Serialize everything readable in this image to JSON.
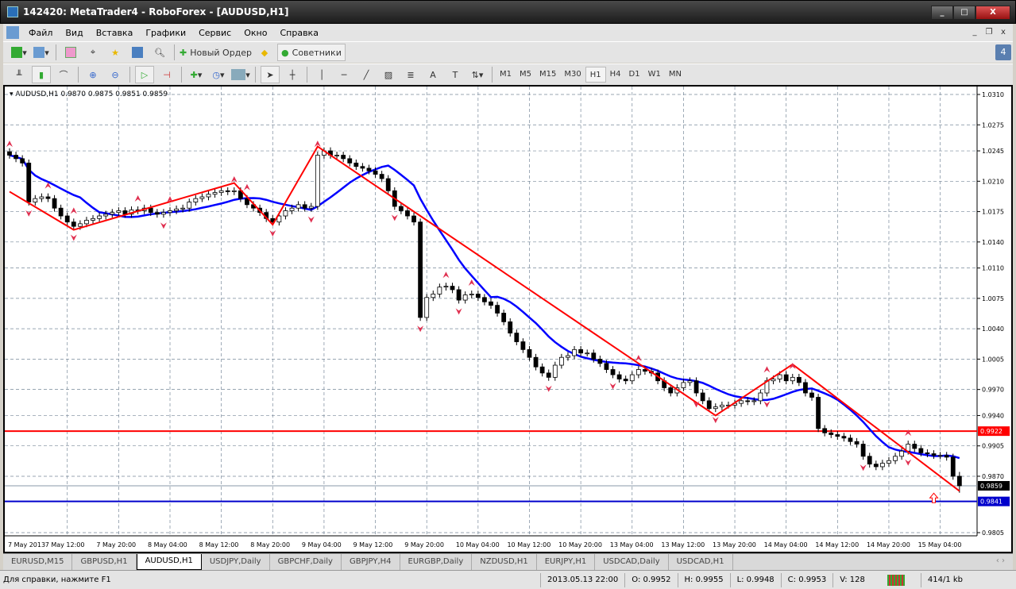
{
  "window": {
    "title": "142420: MetaTrader4 - RoboForex - [AUDUSD,H1]",
    "minimize": "_",
    "maximize": "□",
    "close": "X"
  },
  "menu": [
    "Файл",
    "Вид",
    "Вставка",
    "Графики",
    "Сервис",
    "Окно",
    "Справка"
  ],
  "mdi": {
    "minimize": "_",
    "restore": "❐",
    "close": "x"
  },
  "toolbar1": {
    "new_order": "Новый Ордер",
    "experts": "Советники",
    "notifications": "4"
  },
  "timeframes": [
    "M1",
    "M5",
    "M15",
    "M30",
    "H1",
    "H4",
    "D1",
    "W1",
    "MN"
  ],
  "active_timeframe": "H1",
  "chart_header": "AUDUSD,H1  0.9870 0.9875 0.9851 0.9859",
  "tabs": [
    "EURUSD,M15",
    "GBPUSD,H1",
    "AUDUSD,H1",
    "USDJPY,Daily",
    "GBPCHF,Daily",
    "GBPJPY,H4",
    "EURGBP,Daily",
    "NZDUSD,H1",
    "EURJPY,H1",
    "USDCAD,Daily",
    "USDCAD,H1"
  ],
  "active_tab": "AUDUSD,H1",
  "status": {
    "help": "Для справки, нажмите F1",
    "time": "2013.05.13 22:00",
    "open": "O: 0.9952",
    "high": "H: 0.9955",
    "low": "L: 0.9948",
    "close": "C: 0.9953",
    "volume": "V: 128",
    "traffic": "414/1 kb"
  },
  "colors": {
    "bull": "#ffffff",
    "bear": "#000000",
    "ma": "#0000ff",
    "zigzag": "#ff0000",
    "resistance": "#ff0000",
    "support": "#0000cc",
    "grid": "#778899"
  },
  "chart_data": {
    "type": "candlestick",
    "symbol": "AUDUSD",
    "timeframe": "H1",
    "closes": [
      1.024,
      1.0236,
      1.0231,
      1.0186,
      1.019,
      1.0192,
      1.019,
      1.0179,
      1.017,
      1.0163,
      1.0158,
      1.0161,
      1.0165,
      1.0167,
      1.017,
      1.0172,
      1.0174,
      1.0176,
      1.0172,
      1.0177,
      1.0176,
      1.0179,
      1.0174,
      1.0172,
      1.0174,
      1.0176,
      1.0178,
      1.0179,
      1.0186,
      1.019,
      1.0192,
      1.0195,
      1.0197,
      1.0199,
      1.0198,
      1.0199,
      1.019,
      1.0183,
      1.0179,
      1.0174,
      1.0167,
      1.0163,
      1.017,
      1.0176,
      1.0179,
      1.0183,
      1.0179,
      1.0181,
      1.024,
      1.0245,
      1.024,
      1.024,
      1.0236,
      1.0231,
      1.0227,
      1.0225,
      1.0222,
      1.0218,
      1.0213,
      1.0199,
      1.0181,
      1.0176,
      1.017,
      1.0163,
      1.0053,
      1.0076,
      1.008,
      1.0088,
      1.0089,
      1.0085,
      1.0073,
      1.0079,
      1.008,
      1.0076,
      1.0071,
      1.0067,
      1.0058,
      1.0048,
      1.0035,
      1.0025,
      1.0016,
      1.0007,
      0.9996,
      0.9989,
      0.9984,
      0.9998,
      1.0007,
      1.0009,
      1.0016,
      1.0012,
      1.0012,
      1.0005,
      1.0,
      0.9993,
      0.9987,
      0.9982,
      0.998,
      0.9987,
      0.9993,
      0.9991,
      0.9989,
      0.998,
      0.9972,
      0.9966,
      0.9972,
      0.9978,
      0.998,
      0.9966,
      0.9957,
      0.9948,
      0.995,
      0.9952,
      0.9952,
      0.9954,
      0.9957,
      0.9956,
      0.9957,
      0.9966,
      0.998,
      0.9982,
      0.9987,
      0.998,
      0.9984,
      0.9978,
      0.9966,
      0.9961,
      0.9925,
      0.992,
      0.9918,
      0.9916,
      0.9914,
      0.991,
      0.9907,
      0.9893,
      0.9884,
      0.9881,
      0.9885,
      0.9888,
      0.9893,
      0.9899,
      0.9907,
      0.9902,
      0.9897,
      0.9896,
      0.9894,
      0.9894,
      0.9892,
      0.987,
      0.9859
    ],
    "last_bar": {
      "open": 0.987,
      "high": 0.9875,
      "low": 0.9851,
      "close": 0.9859
    },
    "zigzag": [
      {
        "bar": 0,
        "price": 1.0198
      },
      {
        "bar": 10,
        "price": 1.0154
      },
      {
        "bar": 35,
        "price": 1.0208
      },
      {
        "bar": 41,
        "price": 1.016
      },
      {
        "bar": 48,
        "price": 1.025
      },
      {
        "bar": 110,
        "price": 0.994
      },
      {
        "bar": 122,
        "price": 0.9999
      },
      {
        "bar": 148,
        "price": 0.9853
      }
    ],
    "fractals_up": [
      0,
      6,
      10,
      20,
      25,
      35,
      37,
      48,
      68,
      72,
      98,
      118,
      122,
      140
    ],
    "fractals_down": [
      3,
      10,
      24,
      41,
      47,
      60,
      64,
      70,
      84,
      94,
      107,
      110,
      118,
      133,
      140
    ],
    "hlines": [
      {
        "price": 0.9922,
        "label": "0.9922",
        "color": "#ff0000"
      },
      {
        "price": 0.9841,
        "label": "0.9841",
        "color": "#0000cc"
      },
      {
        "price": 0.9859,
        "label": "0.9859",
        "color": "#000000"
      }
    ],
    "ylim": [
      0.9795,
      1.0318
    ],
    "yticks": [
      "1.0310",
      "1.0275",
      "1.0245",
      "1.0210",
      "1.0175",
      "1.0140",
      "1.0110",
      "1.0075",
      "1.0040",
      "1.0005",
      "0.9970",
      "0.9940",
      "0.9905",
      "0.9870",
      "0.9805"
    ],
    "xticks": [
      {
        "bar": 0,
        "label": "7 May 2013"
      },
      {
        "bar": 9,
        "label": "7 May 12:00"
      },
      {
        "bar": 17,
        "label": "7 May 20:00"
      },
      {
        "bar": 25,
        "label": "8 May 04:00"
      },
      {
        "bar": 33,
        "label": "8 May 12:00"
      },
      {
        "bar": 41,
        "label": "8 May 20:00"
      },
      {
        "bar": 49,
        "label": "9 May 04:00"
      },
      {
        "bar": 57,
        "label": "9 May 12:00"
      },
      {
        "bar": 65,
        "label": "9 May 20:00"
      },
      {
        "bar": 73,
        "label": "10 May 04:00"
      },
      {
        "bar": 81,
        "label": "10 May 12:00"
      },
      {
        "bar": 89,
        "label": "10 May 20:00"
      },
      {
        "bar": 97,
        "label": "13 May 04:00"
      },
      {
        "bar": 105,
        "label": "13 May 12:00"
      },
      {
        "bar": 113,
        "label": "13 May 20:00"
      },
      {
        "bar": 121,
        "label": "14 May 04:00"
      },
      {
        "bar": 129,
        "label": "14 May 12:00"
      },
      {
        "bar": 137,
        "label": "14 May 20:00"
      },
      {
        "bar": 145,
        "label": "15 May 04:00"
      }
    ],
    "grid": true
  }
}
